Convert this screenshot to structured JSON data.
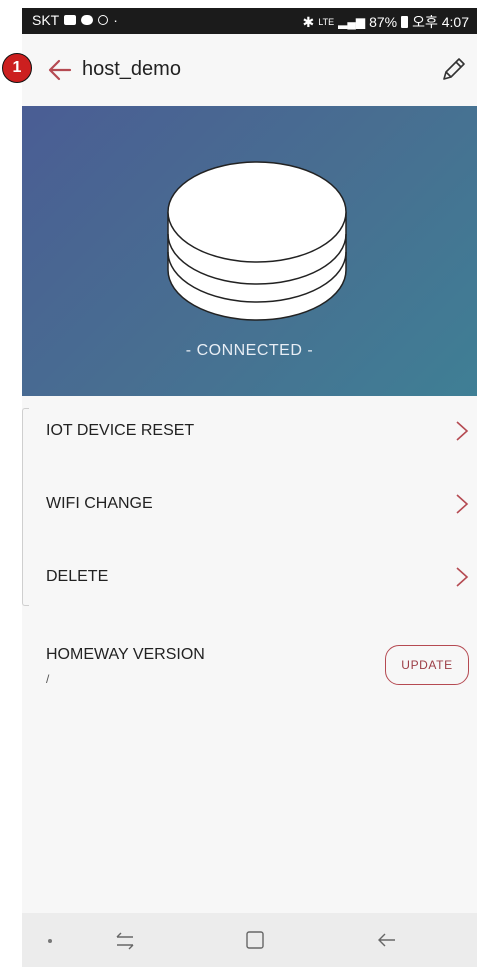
{
  "status_bar": {
    "carrier": "SKT",
    "network": "LTE",
    "battery": "87%",
    "time": "오후 4:07"
  },
  "header": {
    "title": "host_demo"
  },
  "device": {
    "status": "- CONNECTED -"
  },
  "menu": {
    "items": [
      {
        "label": "IOT DEVICE RESET"
      },
      {
        "label": "WIFI CHANGE"
      },
      {
        "label": "DELETE"
      }
    ]
  },
  "version": {
    "label": "HOMEWAY VERSION",
    "value": "/",
    "update_label": "UPDATE"
  },
  "annotation": {
    "badge": "1"
  },
  "colors": {
    "accent": "#b54a52",
    "hero_start": "#4a5d94",
    "hero_end": "#3f7f95",
    "annotation": "#cc1f1f"
  }
}
